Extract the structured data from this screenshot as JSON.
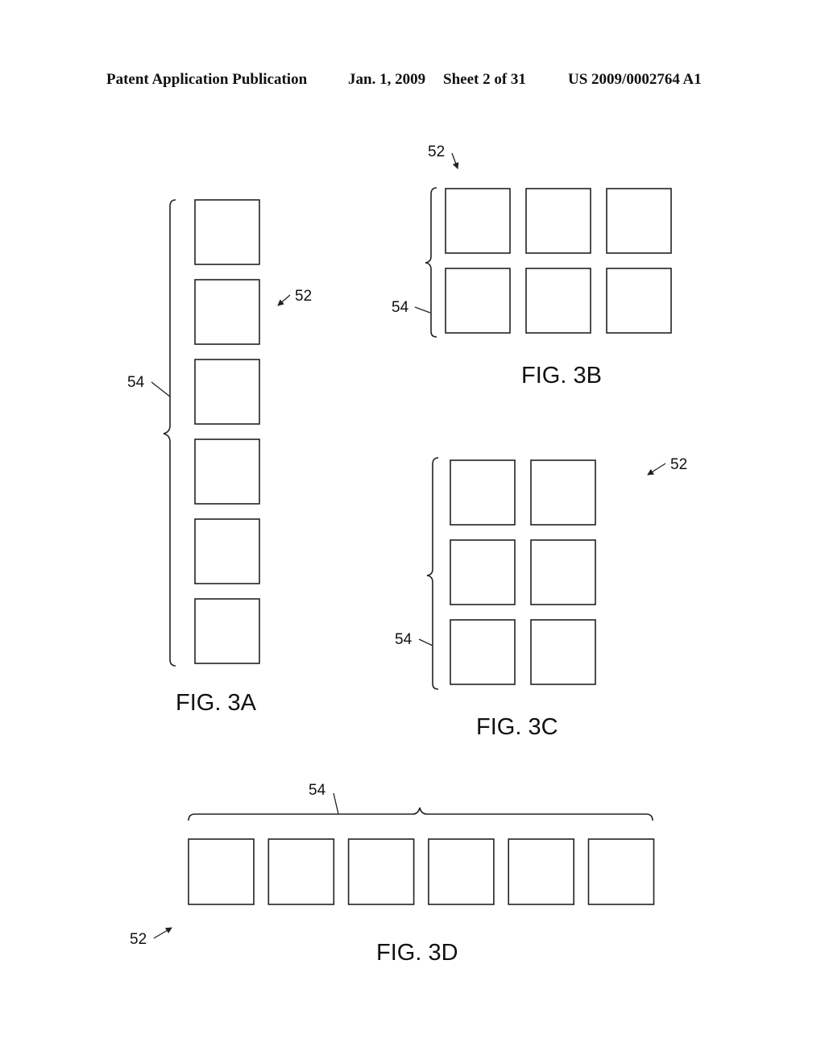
{
  "header": {
    "publication": "Patent Application Publication",
    "date": "Jan. 1, 2009",
    "sheet": "Sheet 2 of 31",
    "number": "US 2009/0002764 A1"
  },
  "figures": [
    {
      "id": "3A",
      "caption": "FIG. 3A",
      "layout": "6 cells in a single column",
      "rows": 6,
      "cols": 1,
      "ref_array": "52",
      "ref_group": "54"
    },
    {
      "id": "3B",
      "caption": "FIG. 3B",
      "layout": "6 cells in 2 rows x 3 columns",
      "rows": 2,
      "cols": 3,
      "ref_array": "52",
      "ref_group": "54"
    },
    {
      "id": "3C",
      "caption": "FIG. 3C",
      "layout": "6 cells in 3 rows x 2 columns",
      "rows": 3,
      "cols": 2,
      "ref_array": "52",
      "ref_group": "54"
    },
    {
      "id": "3D",
      "caption": "FIG. 3D",
      "layout": "6 cells in a single row",
      "rows": 1,
      "cols": 6,
      "ref_array": "52",
      "ref_group": "54"
    }
  ]
}
